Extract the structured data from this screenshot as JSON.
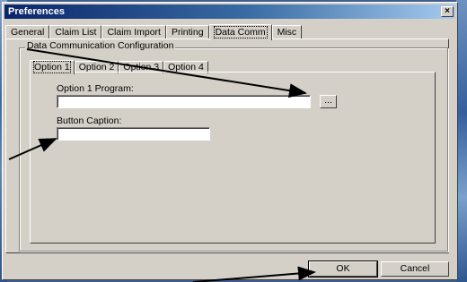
{
  "window": {
    "title": "Preferences",
    "close_glyph": "×"
  },
  "tabs": [
    {
      "label": "General"
    },
    {
      "label": "Claim List"
    },
    {
      "label": "Claim Import"
    },
    {
      "label": "Printing"
    },
    {
      "label": "Data Comm",
      "active": true
    },
    {
      "label": "Misc"
    }
  ],
  "group": {
    "label": "Data Communication Configuration"
  },
  "subtabs": [
    {
      "label": "Option 1",
      "active": true
    },
    {
      "label": "Option 2"
    },
    {
      "label": "Option 3"
    },
    {
      "label": "Option 4"
    }
  ],
  "form": {
    "program_label": "Option 1 Program:",
    "program_value": "",
    "browse_label": "...",
    "caption_label": "Button Caption:",
    "caption_value": ""
  },
  "footer": {
    "ok_label": "OK",
    "cancel_label": "Cancel"
  },
  "annotation": {
    "arrow_color": "#000000",
    "arrow_count": 4
  }
}
